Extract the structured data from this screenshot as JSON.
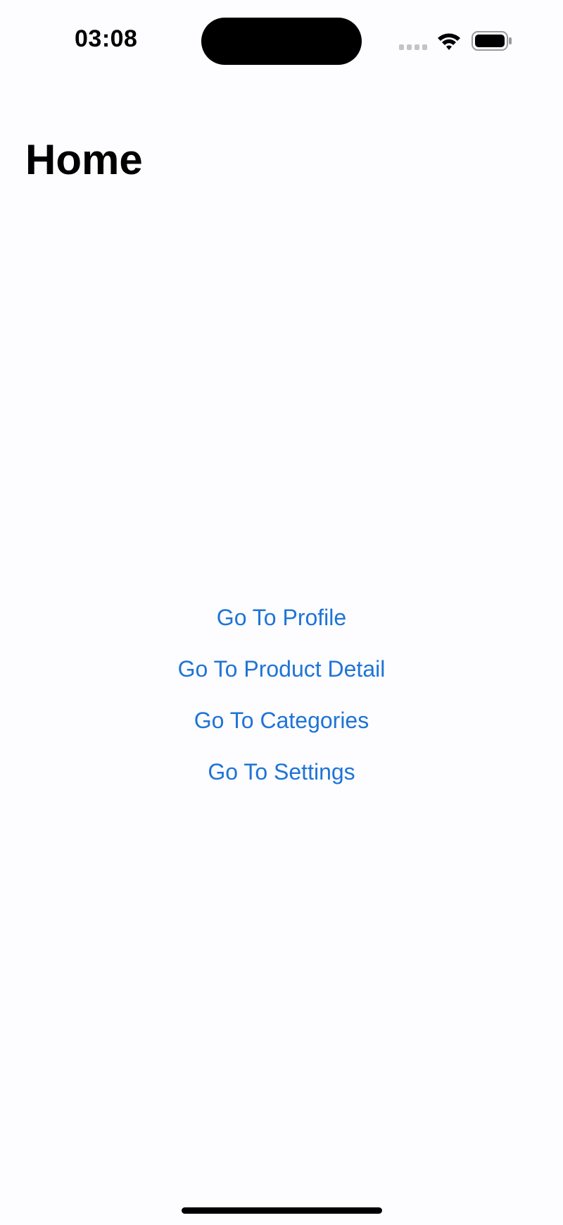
{
  "status_bar": {
    "time": "03:08",
    "icons": [
      "signal-icon",
      "wifi-icon",
      "battery-icon"
    ]
  },
  "header": {
    "title": "Home"
  },
  "nav": {
    "items": [
      {
        "label": "Go To Profile"
      },
      {
        "label": "Go To Product Detail"
      },
      {
        "label": "Go To Categories"
      },
      {
        "label": "Go To Settings"
      }
    ]
  },
  "colors": {
    "accent": "#1e74d6",
    "background": "#fdfcfe",
    "text": "#000000"
  }
}
